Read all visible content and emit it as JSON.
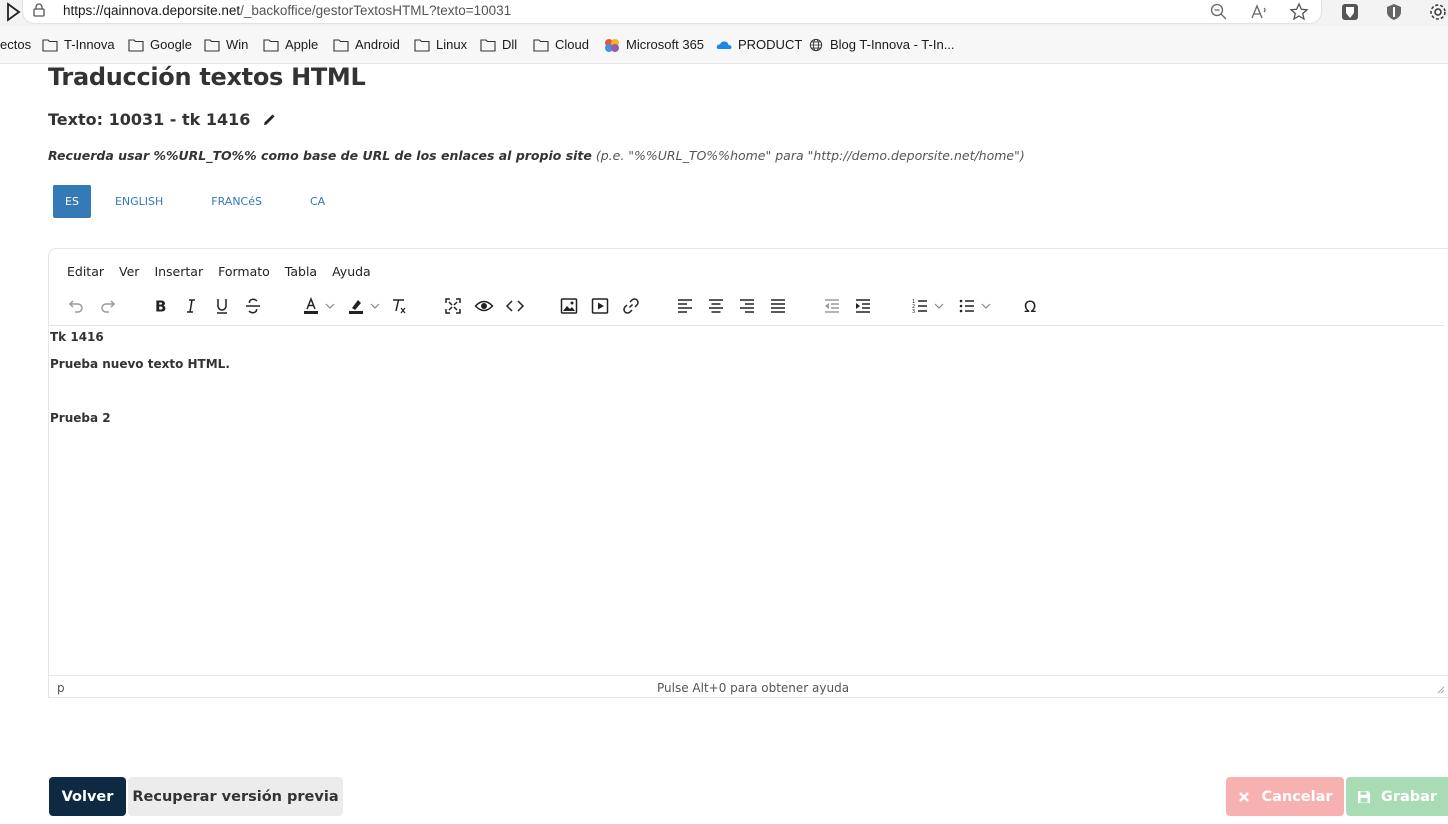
{
  "browser": {
    "url_host": "https://qainnova.deporsite.net",
    "url_path": "/_backoffice/gestorTextosHTML?texto=10031",
    "bookmarks": [
      "ectos",
      "T-Innova",
      "Google",
      "Win",
      "Apple",
      "Android",
      "Linux",
      "Dll",
      "Cloud",
      "Microsoft 365",
      "PRODUCT",
      "Blog T-Innova - T-In..."
    ]
  },
  "page": {
    "title": "Traducción textos HTML",
    "text_title": "Texto: 10031 - tk 1416",
    "hint_bold": "Recuerda usar %%URL_TO%% como base de URL de los enlaces al propio site",
    "hint_light": "(p.e. \"%%URL_TO%%home\" para \"http://demo.deporsite.net/home\")"
  },
  "tabs": [
    {
      "label": "ES",
      "active": true
    },
    {
      "label": "ENGLISH",
      "active": false
    },
    {
      "label": "FRANCéS",
      "active": false
    },
    {
      "label": "CA",
      "active": false
    }
  ],
  "editor": {
    "menu": [
      "Editar",
      "Ver",
      "Insertar",
      "Formato",
      "Tabla",
      "Ayuda"
    ],
    "content": {
      "line1": "Tk 1416",
      "line2": "Prueba nuevo texto HTML.",
      "line3": "Prueba 2"
    },
    "status_path": "p",
    "status_help": "Pulse Alt+0 para obtener ayuda"
  },
  "buttons": {
    "volver": "Volver",
    "recuperar": "Recuperar versión previa",
    "cancelar": "Cancelar",
    "grabar": "Grabar"
  },
  "colors": {
    "tab_active": "#337ab7",
    "volver_bg": "#0e2a42",
    "cancelar_bg": "#f7b1b1",
    "grabar_bg": "#a9dcb4"
  }
}
